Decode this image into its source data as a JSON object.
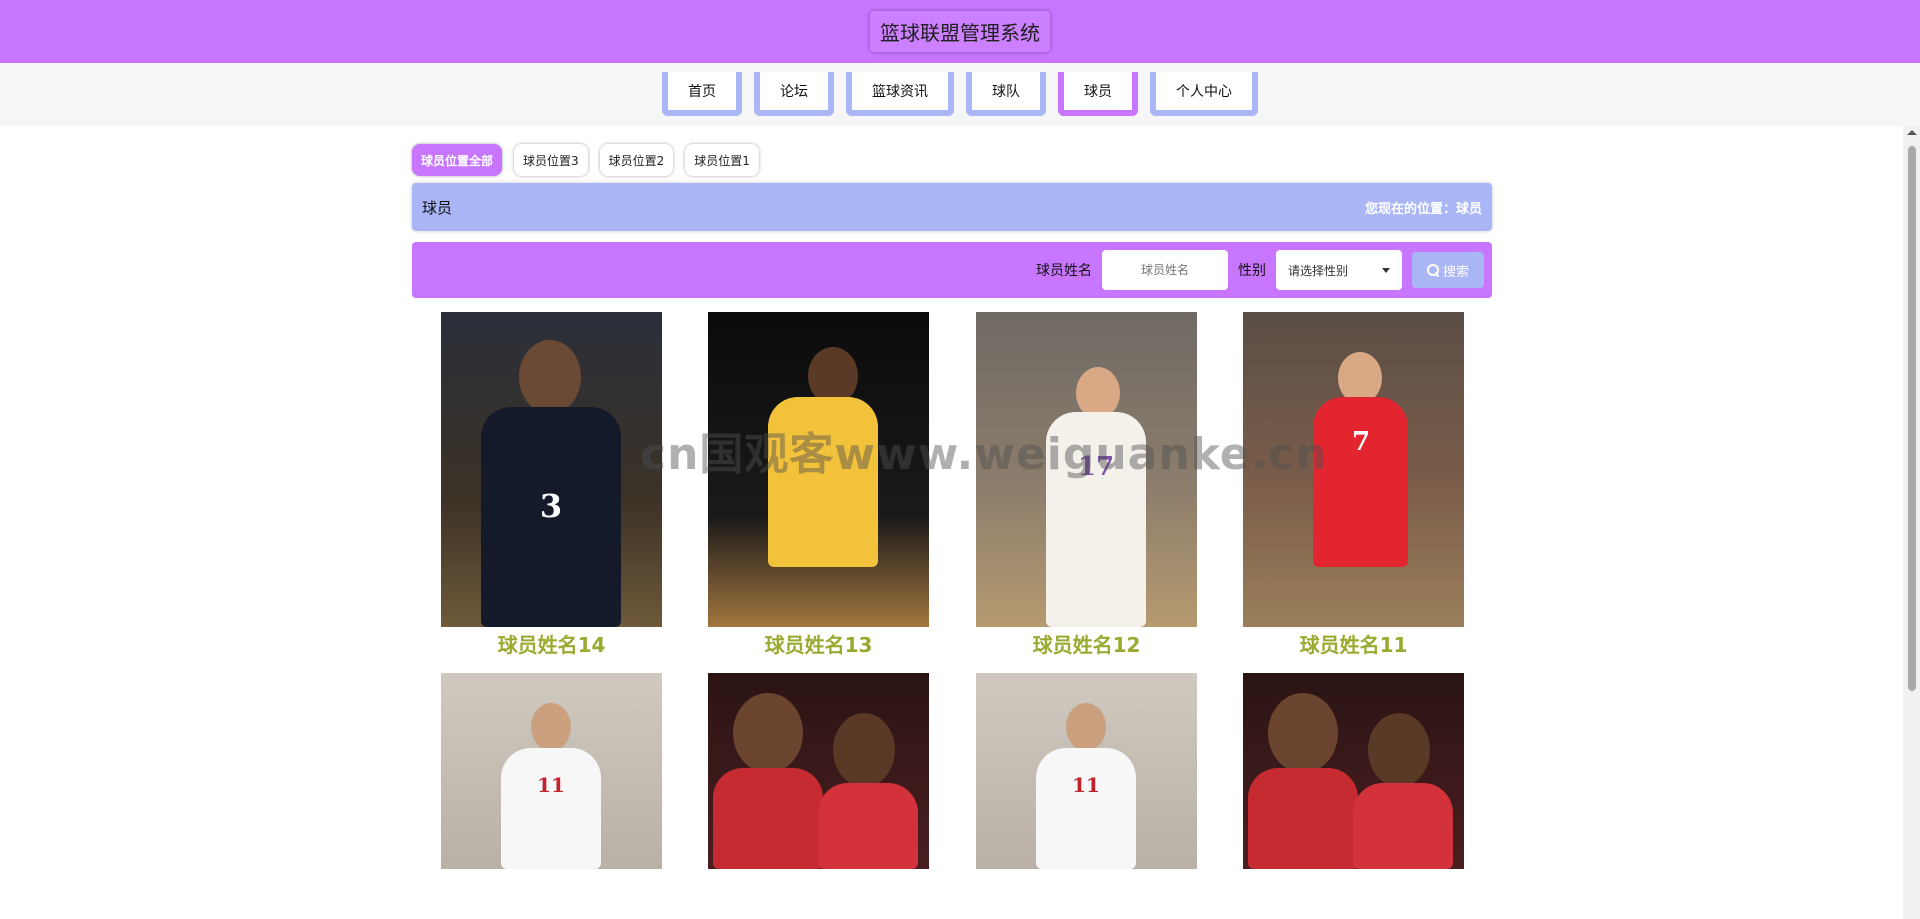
{
  "header": {
    "title": "篮球联盟管理系统"
  },
  "nav": {
    "items": [
      {
        "label": "首页"
      },
      {
        "label": "论坛"
      },
      {
        "label": "篮球资讯"
      },
      {
        "label": "球队"
      },
      {
        "label": "球员"
      },
      {
        "label": "个人中心"
      }
    ],
    "active": "球员"
  },
  "filters": {
    "items": [
      {
        "label": "球员位置全部"
      },
      {
        "label": "球员位置3"
      },
      {
        "label": "球员位置2"
      },
      {
        "label": "球员位置1"
      }
    ],
    "active": "球员位置全部"
  },
  "breadcrumb": {
    "title": "球员",
    "location": "您现在的位置：球员"
  },
  "search": {
    "name_label": "球员姓名",
    "name_placeholder": "球员姓名",
    "gender_label": "性别",
    "gender_selected": "请选择性别",
    "button_label": "搜索"
  },
  "players": [
    {
      "name": "球员姓名14",
      "number": "3"
    },
    {
      "name": "球员姓名13",
      "number": ""
    },
    {
      "name": "球员姓名12",
      "number": "17"
    },
    {
      "name": "球员姓名11",
      "number": "7"
    },
    {
      "name": "",
      "number": "11"
    },
    {
      "name": "",
      "number": ""
    },
    {
      "name": "",
      "number": "11"
    },
    {
      "name": "",
      "number": ""
    }
  ],
  "watermark": "cn国观客www.weiguanke.cn",
  "colors": {
    "primary": "#c875ff",
    "secondary": "#aab6f6",
    "name_text": "#9aaa30"
  }
}
